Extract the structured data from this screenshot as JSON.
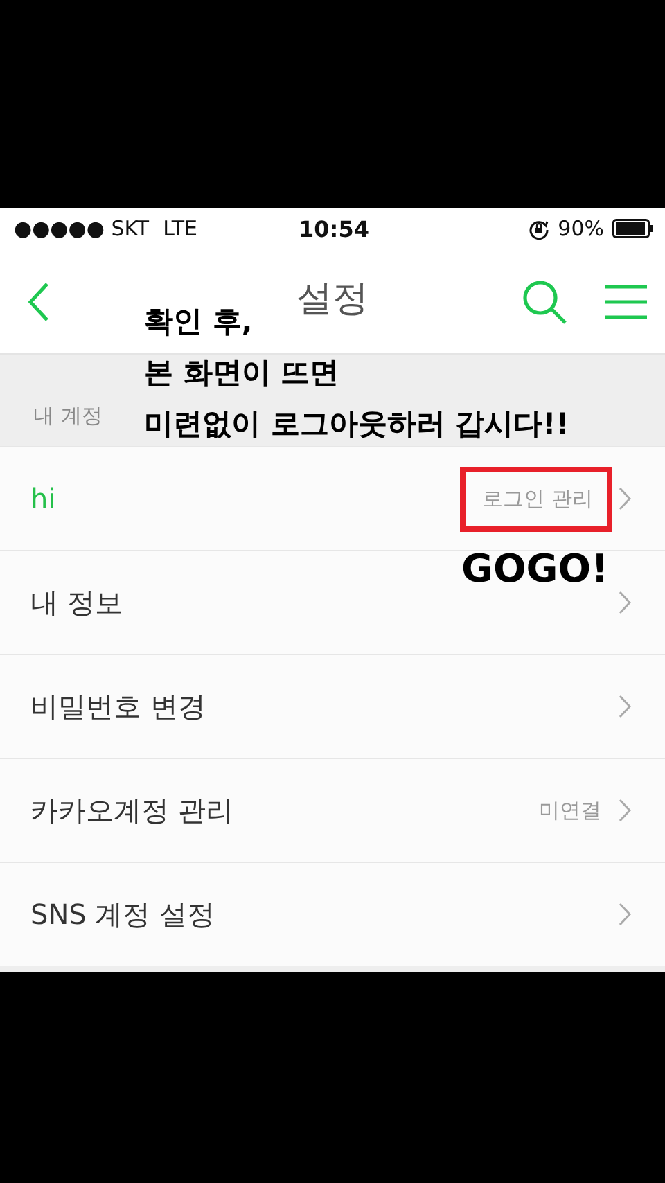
{
  "status_bar": {
    "carrier": "●●●●● SKT",
    "network": "LTE",
    "time": "10:54",
    "battery": "90%"
  },
  "nav": {
    "title": "설정"
  },
  "section": {
    "title": "내 계정"
  },
  "rows": [
    {
      "label": "hi",
      "value": "로그인 관리",
      "accent": true,
      "boxed": true
    },
    {
      "label": "내 정보",
      "accent": false
    },
    {
      "label": "비밀번호 변경",
      "accent": false
    },
    {
      "label": "카카오계정 관리",
      "value": "미연결",
      "accent": false,
      "boxed": false
    },
    {
      "label": "SNS 계정 설정",
      "accent": false
    }
  ],
  "annotation": {
    "note_lines": [
      "확인 후,",
      "본 화면이 뜨면",
      "미련없이 로그아웃하러 갑시다!!"
    ],
    "callout": "GOGO!"
  }
}
